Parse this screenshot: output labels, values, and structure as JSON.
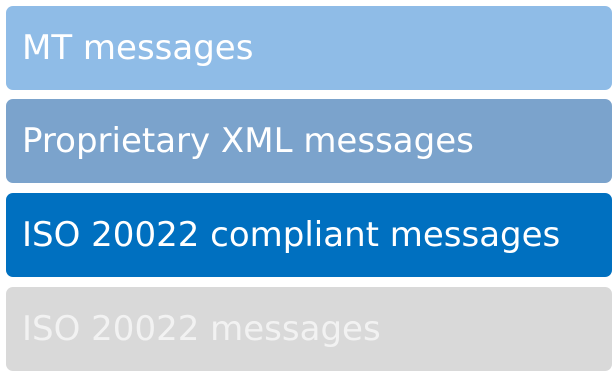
{
  "layers": [
    {
      "label": "MT messages",
      "background": "#8fbce7",
      "text_color": "#ffffff"
    },
    {
      "label": "Proprietary XML messages",
      "background": "#7ba3cc",
      "text_color": "#ffffff"
    },
    {
      "label": "ISO 20022 compliant messages",
      "background": "#0070c0",
      "text_color": "#ffffff"
    },
    {
      "label": "ISO 20022 messages",
      "background": "#d9d9d9",
      "text_color": "#f2f2f2"
    }
  ]
}
